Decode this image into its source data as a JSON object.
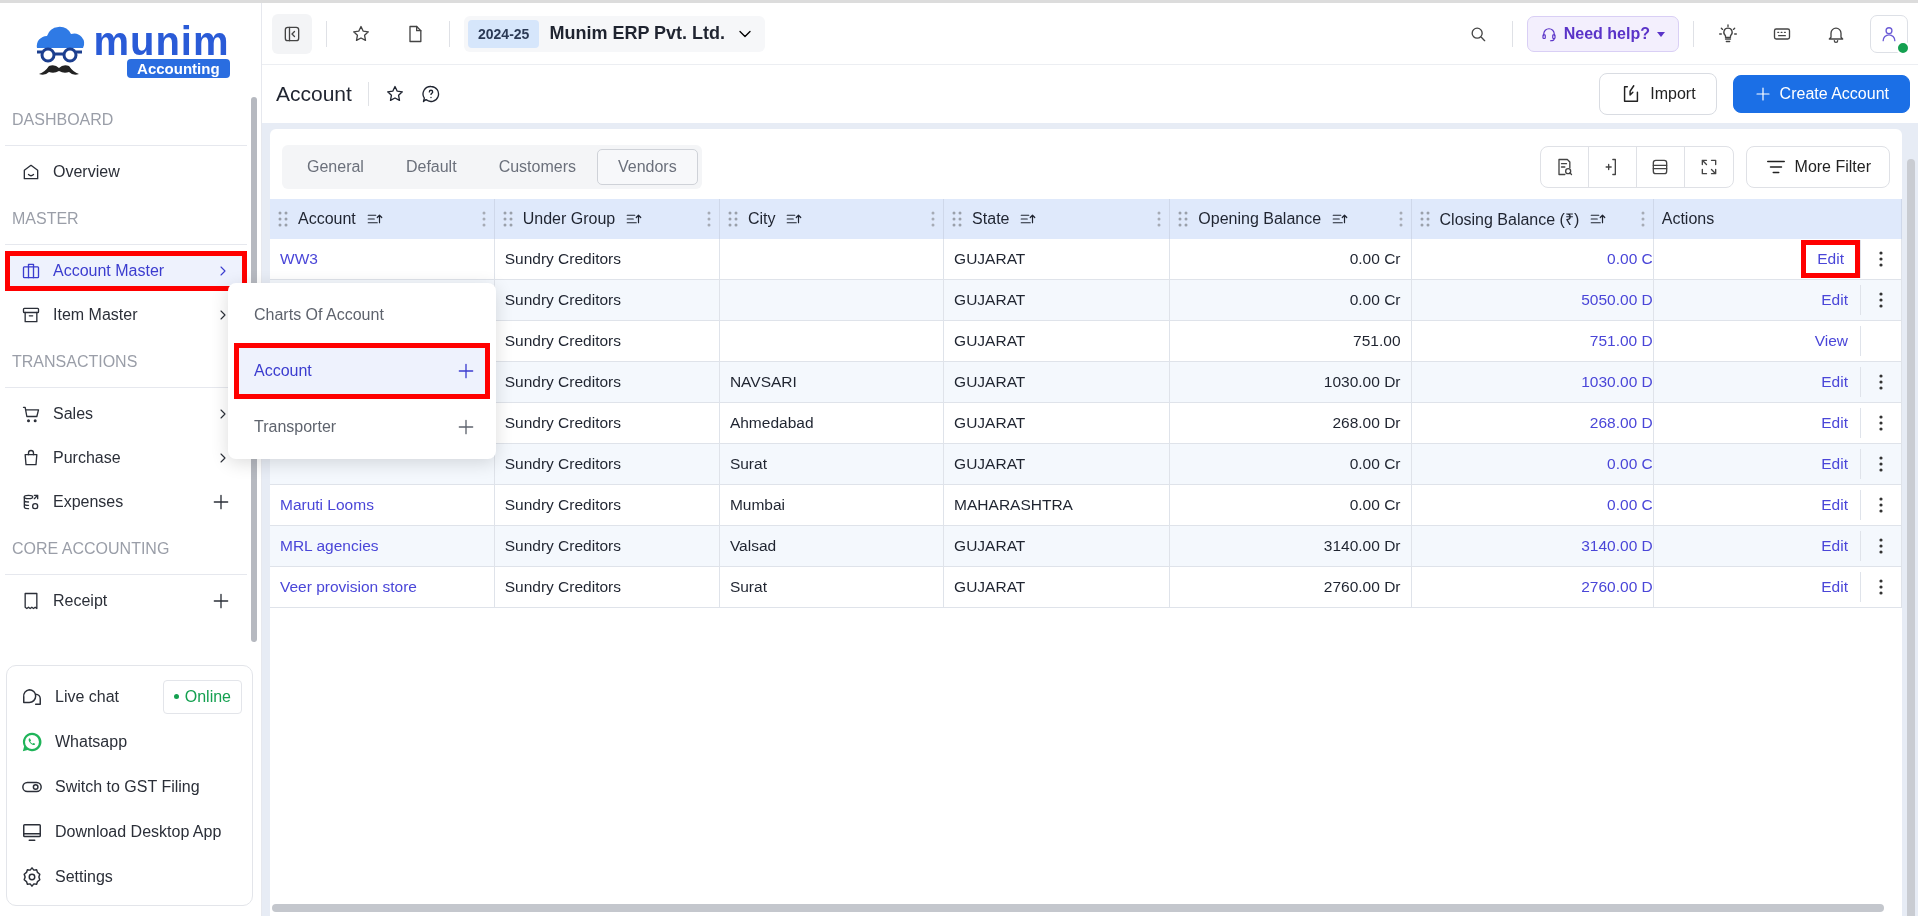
{
  "sidebar": {
    "logo": {
      "name": "munim",
      "tag": "Accounting"
    },
    "sections": [
      {
        "title": "DASHBOARD",
        "items": [
          {
            "label": "Overview",
            "kind": "plain",
            "selected": false,
            "highlighted": false
          }
        ]
      },
      {
        "title": "MASTER",
        "items": [
          {
            "label": "Account Master",
            "kind": "submenu",
            "selected": true,
            "highlighted": true
          },
          {
            "label": "Item Master",
            "kind": "submenu",
            "selected": false,
            "highlighted": false
          }
        ]
      },
      {
        "title": "TRANSACTIONS",
        "items": [
          {
            "label": "Sales",
            "kind": "submenu",
            "selected": false,
            "highlighted": false
          },
          {
            "label": "Purchase",
            "kind": "submenu",
            "selected": false,
            "highlighted": false
          },
          {
            "label": "Expenses",
            "kind": "add",
            "selected": false,
            "highlighted": false
          }
        ]
      },
      {
        "title": "CORE ACCOUNTING",
        "items": [
          {
            "label": "Receipt",
            "kind": "add",
            "selected": false,
            "highlighted": false
          }
        ]
      }
    ],
    "footer": [
      {
        "label": "Live chat",
        "badge": "Online"
      },
      {
        "label": "Whatsapp"
      },
      {
        "label": "Switch to GST Filing"
      },
      {
        "label": "Download Desktop App"
      },
      {
        "label": "Settings"
      }
    ]
  },
  "submenu": [
    {
      "label": "Charts Of Account",
      "add": false,
      "selected": false,
      "highlighted": false
    },
    {
      "label": "Account",
      "add": true,
      "selected": true,
      "highlighted": true
    },
    {
      "label": "Transporter",
      "add": true,
      "selected": false,
      "highlighted": false
    }
  ],
  "topbar": {
    "year": "2024-25",
    "company": "Munim ERP Pvt. Ltd.",
    "help": "Need help?",
    "online": true
  },
  "page": {
    "title": "Account",
    "import": "Import",
    "create": "Create Account"
  },
  "tabs": [
    {
      "label": "General",
      "selected": false
    },
    {
      "label": "Default",
      "selected": false
    },
    {
      "label": "Customers",
      "selected": false
    },
    {
      "label": "Vendors",
      "selected": true
    }
  ],
  "more_filter": "More Filter",
  "table": {
    "columns": [
      {
        "label": "Account",
        "sortable": true
      },
      {
        "label": "Under Group",
        "sortable": true
      },
      {
        "label": "City",
        "sortable": true
      },
      {
        "label": "State",
        "sortable": true
      },
      {
        "label": "Opening Balance",
        "sortable": true
      },
      {
        "label": "Closing Balance (₹)",
        "sortable": true
      },
      {
        "label": "Actions",
        "sortable": false
      }
    ],
    "rows": [
      {
        "account": "WW3",
        "group": "Sundry Creditors",
        "state": "GUJARAT",
        "opening": "0.00 Cr",
        "closing": "0.00 C",
        "action": "Edit",
        "menu": true,
        "highlighted": true
      },
      {
        "group": "Sundry Creditors",
        "state": "GUJARAT",
        "opening": "0.00 Cr",
        "closing": "5050.00 D",
        "action": "Edit",
        "menu": true,
        "highlighted": false
      },
      {
        "group": "Sundry Creditors",
        "state": "GUJARAT",
        "opening": "751.00",
        "closing": "751.00 D",
        "action": "View",
        "menu": false,
        "highlighted": false
      },
      {
        "group": "Sundry Creditors",
        "city": "NAVSARI",
        "state": "GUJARAT",
        "opening": "1030.00 Dr",
        "closing": "1030.00 D",
        "action": "Edit",
        "menu": true,
        "highlighted": false
      },
      {
        "group": "Sundry Creditors",
        "city": "Ahmedabad",
        "state": "GUJARAT",
        "opening": "268.00 Dr",
        "closing": "268.00 D",
        "action": "Edit",
        "menu": true,
        "highlighted": false
      },
      {
        "group": "Sundry Creditors",
        "city": "Surat",
        "state": "GUJARAT",
        "opening": "0.00 Cr",
        "closing": "0.00 C",
        "action": "Edit",
        "menu": true,
        "highlighted": false
      },
      {
        "account": "Maruti Looms",
        "group": "Sundry Creditors",
        "city": "Mumbai",
        "state": "MAHARASHTRA",
        "opening": "0.00 Cr",
        "closing": "0.00 C",
        "action": "Edit",
        "menu": true,
        "highlighted": false
      },
      {
        "account": "MRL agencies",
        "group": "Sundry Creditors",
        "city": "Valsad",
        "state": "GUJARAT",
        "opening": "3140.00 Dr",
        "closing": "3140.00 D",
        "action": "Edit",
        "menu": true,
        "highlighted": false
      },
      {
        "account": "Veer provision store",
        "group": "Sundry Creditors",
        "city": "Surat",
        "state": "GUJARAT",
        "opening": "2760.00 Dr",
        "closing": "2760.00 D",
        "action": "Edit",
        "menu": true,
        "highlighted": false
      }
    ]
  }
}
